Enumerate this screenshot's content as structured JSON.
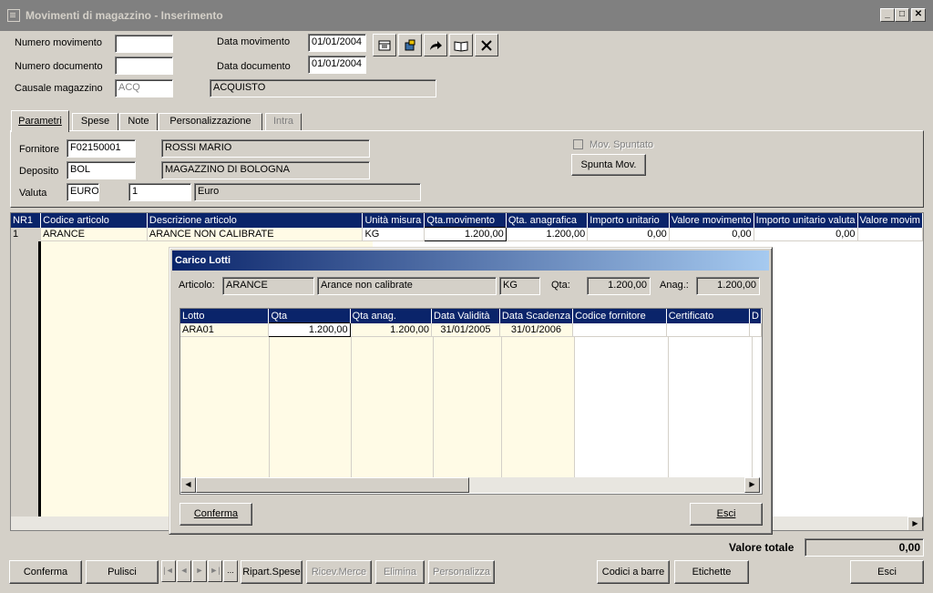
{
  "window": {
    "title": "Movimenti di magazzino - Inserimento",
    "icon": "form-icon",
    "btn_min": "_",
    "btn_max": "□",
    "btn_close": "✕"
  },
  "header": {
    "numero_movimento_label": "Numero movimento",
    "numero_movimento_value": "",
    "numero_documento_label": "Numero documento",
    "numero_documento_value": "",
    "causale_label": "Causale magazzino",
    "causale_code": "ACQ",
    "causale_desc": "ACQUISTO",
    "data_movimento_label": "Data movimento",
    "data_movimento_value": "01/01/2004",
    "data_documento_label": "Data documento",
    "data_documento_value": "01/01/2004"
  },
  "toolbar_icons": [
    "calendar-icon",
    "copy-flag-icon",
    "redo-arrow-icon",
    "book-icon",
    "delete-x-icon"
  ],
  "tabs": [
    {
      "label": "Parametri",
      "active": true
    },
    {
      "label": "Spese",
      "active": false
    },
    {
      "label": "Note",
      "active": false
    },
    {
      "label": "Personalizzazione",
      "active": false
    },
    {
      "label": "Intra",
      "active": false,
      "disabled": true
    }
  ],
  "parametri": {
    "fornitore_label": "Fornitore",
    "fornitore_code": "F02150001",
    "fornitore_name": "ROSSI MARIO",
    "deposito_label": "Deposito",
    "deposito_code": "BOL",
    "deposito_name": "MAGAZZINO DI BOLOGNA",
    "valuta_label": "Valuta",
    "valuta_code": "EURO",
    "valuta_num": "1",
    "valuta_name": "Euro",
    "mov_spuntato_label": "Mov. Spuntato",
    "spunta_button": "Spunta Mov."
  },
  "main_grid": {
    "columns": [
      "NR1",
      "Codice articolo",
      "Descrizione articolo",
      "Unità misura",
      "Qta.movimento",
      "Qta. anagrafica",
      "Importo unitario",
      "Valore movimento",
      "Importo unitario valuta",
      "Valore movim"
    ],
    "rows": [
      [
        "1",
        "ARANCE",
        "ARANCE NON CALIBRATE",
        "KG",
        "1.200,00",
        "1.200,00",
        "0,00",
        "0,00",
        "0,00",
        ""
      ]
    ]
  },
  "dialog": {
    "title": "Carico Lotti",
    "articolo_label": "Articolo:",
    "articolo_code": "ARANCE",
    "articolo_desc": "Arance non calibrate",
    "um": "KG",
    "qta_label": "Qta:",
    "qta_value": "1.200,00",
    "anag_label": "Anag.:",
    "anag_value": "1.200,00",
    "grid": {
      "columns": [
        "Lotto",
        "Qta",
        "Qta anag.",
        "Data Validità",
        "Data Scadenza",
        "Codice fornitore",
        "Certificato",
        "D"
      ],
      "rows": [
        [
          "ARA01",
          "1.200,00",
          "1.200,00",
          "31/01/2005",
          "31/01/2006",
          "",
          "",
          ""
        ]
      ]
    },
    "conferma": "Conferma",
    "esci": "Esci"
  },
  "footer": {
    "valore_totale_label": "Valore totale",
    "valore_totale_value": "0,00",
    "buttons": {
      "conferma": "Conferma",
      "pulisci": "Pulisci",
      "ripart_spese": "Ripart.Spese",
      "ricev_merce": "Ricev.Merce",
      "elimina": "Elimina",
      "personalizza": "Personalizza",
      "codici_barre": "Codici a barre",
      "etichette": "Etichette",
      "esci": "Esci"
    },
    "nav": [
      "|◄",
      "◄",
      "►",
      "►|",
      "..."
    ]
  }
}
